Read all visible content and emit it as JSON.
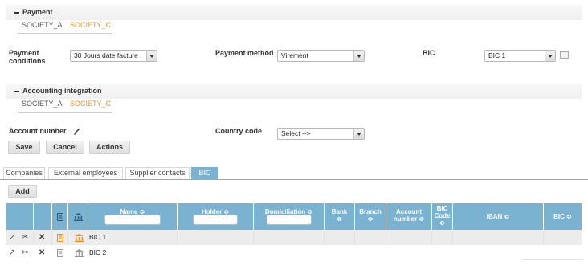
{
  "payment": {
    "title": "Payment",
    "tabs": [
      "SOCIETY_A",
      "SOCIETY_C"
    ],
    "active_tab": "SOCIETY_C",
    "conditions_label": "Payment conditions",
    "conditions_value": "30 Jours date facture",
    "method_label": "Payment method",
    "method_value": "Virement",
    "bic_label": "BIC",
    "bic_value": "BIC 1"
  },
  "accounting": {
    "title": "Accounting integration",
    "tabs": [
      "SOCIETY_A",
      "SOCIETY_C"
    ],
    "active_tab": "SOCIETY_C",
    "account_number_label": "Account number",
    "country_code_label": "Country code",
    "country_code_value": "Select -->"
  },
  "actions": {
    "save": "Save",
    "cancel": "Cancel",
    "actions": "Actions"
  },
  "main_tabs": [
    "Companies",
    "External employees",
    "Supplier contacts",
    "BIC"
  ],
  "active_main_tab": "BIC",
  "grid": {
    "add_label": "Add",
    "columns": [
      "Name ≎",
      "Holder ≎",
      "Domiciliation ≎",
      "Bank ≎",
      "Branch ≎",
      "Account number ≎",
      "BIC Code ≎",
      "IBAN ≎",
      "BIC ≎"
    ],
    "rows": [
      {
        "name": "BIC 1",
        "highlighted": true
      },
      {
        "name": "BIC 2",
        "highlighted": false
      }
    ]
  },
  "colors": {
    "accent": "#f0901e",
    "header": "#7ab3d2"
  }
}
